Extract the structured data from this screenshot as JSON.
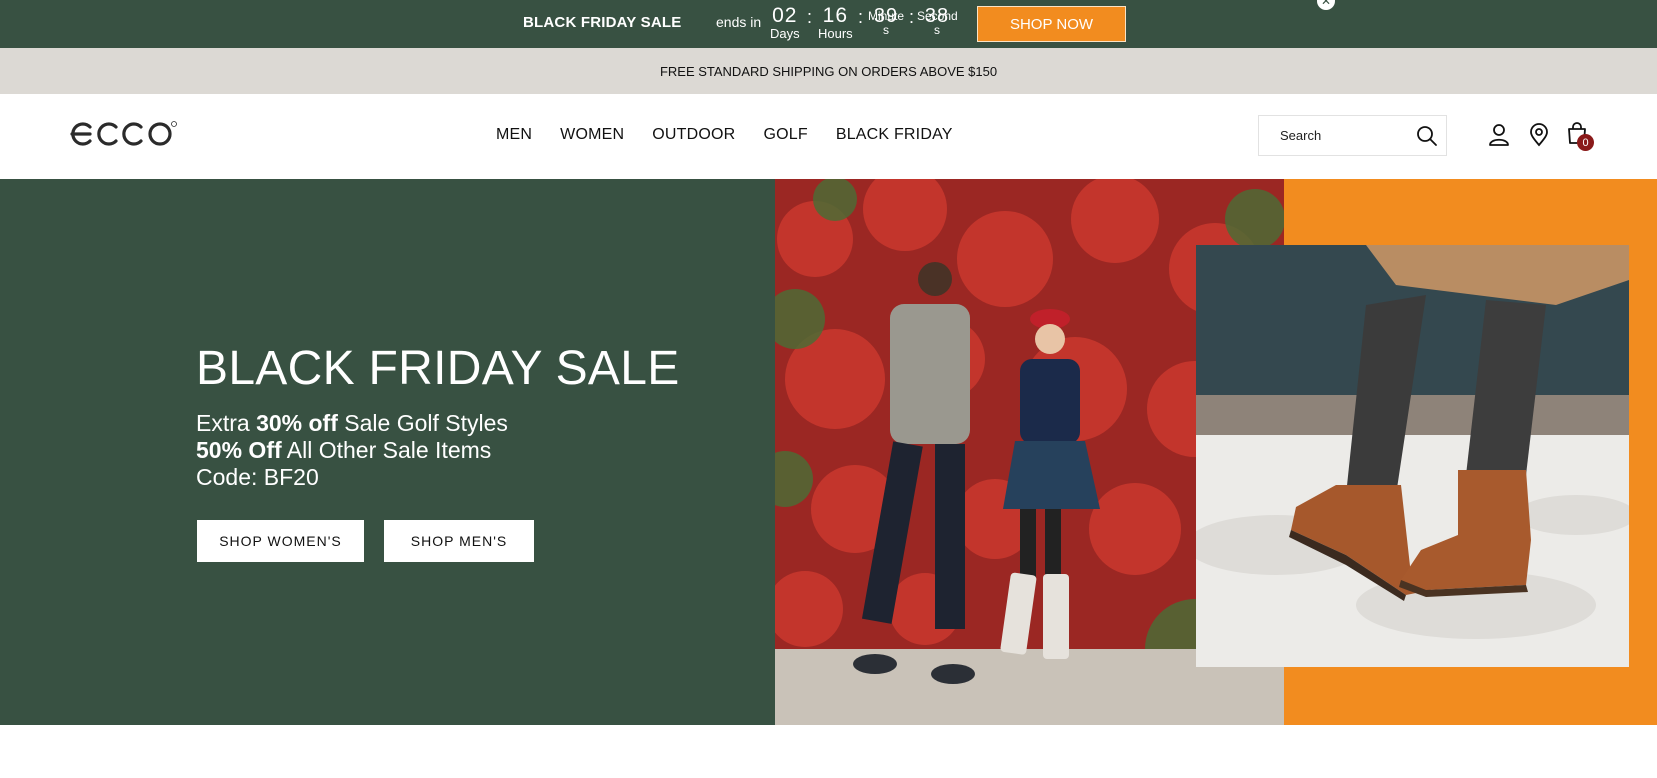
{
  "promo": {
    "title": "BLACK FRIDAY SALE",
    "ends_text": "ends in",
    "countdown": [
      {
        "value": "02",
        "label": "Days"
      },
      {
        "value": "16",
        "label": "Hours"
      },
      {
        "value": "39",
        "label": "Minute s"
      },
      {
        "value": "38",
        "label": "Second s"
      }
    ],
    "shop_now": "SHOP NOW",
    "close_icon": "close-icon"
  },
  "shipping": {
    "text": "FREE STANDARD SHIPPING ON ORDERS ABOVE $150"
  },
  "header": {
    "logo": "ecco",
    "nav": [
      "MEN",
      "WOMEN",
      "OUTDOOR",
      "GOLF",
      "BLACK FRIDAY"
    ],
    "search": {
      "placeholder": "Search",
      "icon": "search-icon"
    },
    "icons": [
      "user-icon",
      "location-pin-icon",
      "shopping-bag-icon"
    ],
    "cart_count": "0"
  },
  "hero": {
    "title": "BLACK FRIDAY SALE",
    "line1_a": "Extra ",
    "line1_b": "30% off",
    "line1_c": " Sale Golf Styles",
    "line2_a": "50% Off",
    "line2_b": " All Other Sale Items",
    "line3": "Code: BF20",
    "btn_women": "SHOP WOMEN'S",
    "btn_men": "SHOP MEN'S"
  },
  "colors": {
    "brand_green": "#385142",
    "accent_orange": "#f28c1f",
    "shipping_bg": "#dcd9d4",
    "badge_red": "#8a1a1a"
  }
}
